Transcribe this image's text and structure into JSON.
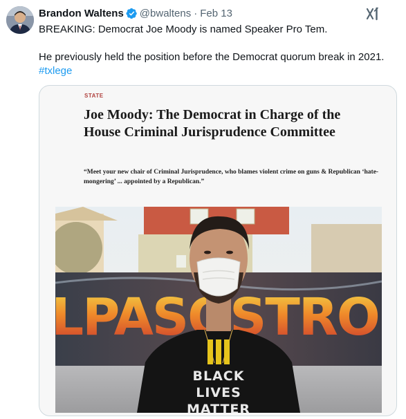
{
  "tweet": {
    "display_name": "Brandon Waltens",
    "handle": "@bwaltens",
    "separator": "·",
    "date": "Feb 13",
    "line1": "BREAKING: Democrat Joe Moody is named Speaker Pro Tem.",
    "line2": "He previously held the position before the Democrat quorum break in 2021.",
    "hashtag": "#txlege"
  },
  "card": {
    "section": "STATE",
    "headline": "Joe Moody: The Democrat in Charge of the House Criminal Jurisprudence Committee",
    "dek": "“Meet your new chair of Criminal Jurisprudence, who blames violent crime on guns & Republican ‘hate-mongering’ ... appointed by a Republican.”",
    "mural_text": "LPASOSTRO",
    "shirt_text": [
      "BLACK",
      "LIVES",
      "MATTER"
    ]
  },
  "colors": {
    "link": "#1d9bf0",
    "verified": "#1d9bf0",
    "secondary_text": "#536471",
    "section_red": "#b0413e"
  },
  "icons": [
    "verified-badge-icon",
    "grok-icon"
  ]
}
